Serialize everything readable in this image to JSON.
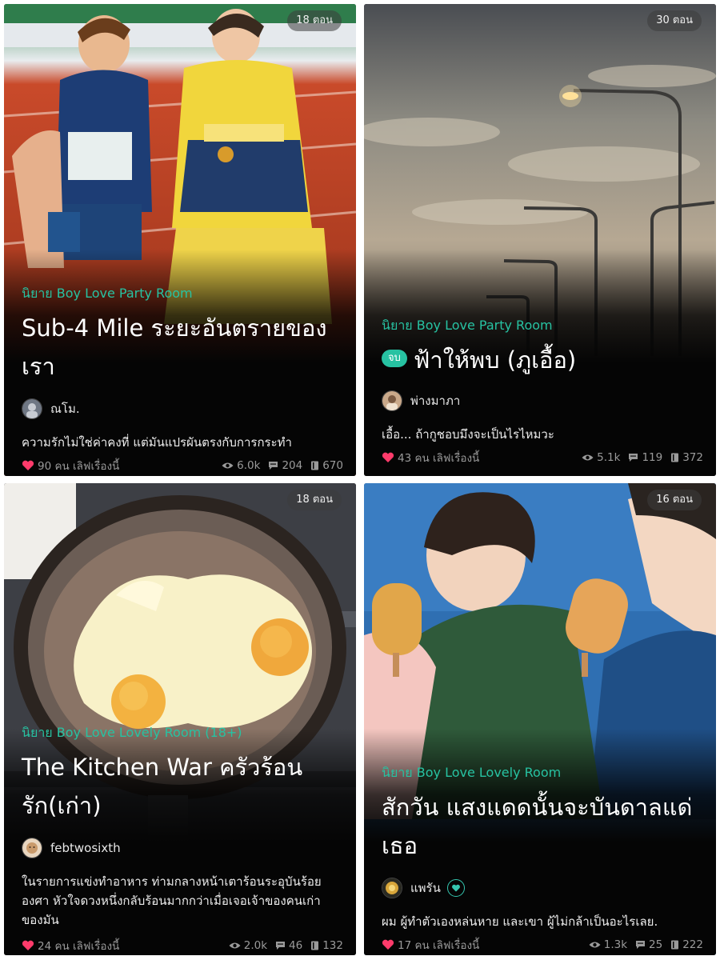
{
  "cards": [
    {
      "episodes": "18 ตอน",
      "category": "นิยาย Boy Love Party Room",
      "status_badge": "",
      "title": "Sub-4 Mile ระยะอันตรายของเรา",
      "author": "ณโม.",
      "description": "ความรักไม่ใช่ค่าคงที่ แต่มันแปรผันตรงกับการกระทำ",
      "likes": "90 คน เลิฟเรื่องนี้",
      "views": "6.0k",
      "comments": "204",
      "chapters": "670"
    },
    {
      "episodes": "30 ตอน",
      "category": "นิยาย Boy Love Party Room",
      "status_badge": "จบ",
      "title": "ฟ้าให้พบ (ภูเอื้อ)",
      "author": "พ่างมาภา",
      "description": "เอื้อ... ถ้ากูชอบมึงจะเป็นไรไหมวะ",
      "likes": "43 คน เลิฟเรื่องนี้",
      "views": "5.1k",
      "comments": "119",
      "chapters": "372"
    },
    {
      "episodes": "18 ตอน",
      "category": "นิยาย Boy Love Lovely Room (18+)",
      "status_badge": "",
      "title": "The Kitchen War ครัวร้อนรัก(เก่า)",
      "author": "febtwosixth",
      "description": "ในรายการแข่งทำอาหาร ท่ามกลางหน้าเตาร้อนระอุบันร้อยองศา หัวใจดวงหนึ่งกลับร้อนมากกว่าเมื่อเจอเจ้าของคนเก่าของมัน",
      "likes": "24 คน เลิฟเรื่องนี้",
      "views": "2.0k",
      "comments": "46",
      "chapters": "132"
    },
    {
      "episodes": "16 ตอน",
      "category": "นิยาย Boy Love Lovely Room",
      "status_badge": "",
      "title": "สักวัน แสงแดดนั้นจะบันดาลแด่เธอ",
      "author": "แพรัน",
      "description": "ผม ผู้ทำตัวเองหล่นหาย และเขา ผู้ไม่กล้าเป็นอะไรเลย.",
      "likes": "17 คน เลิฟเรื่องนี้",
      "views": "1.3k",
      "comments": "25",
      "chapters": "222"
    }
  ],
  "colors": {
    "accent": "#27c2a2",
    "heart": "#ff3b6b",
    "card_bg": "#050505",
    "stat_text": "#9a9a9a"
  }
}
